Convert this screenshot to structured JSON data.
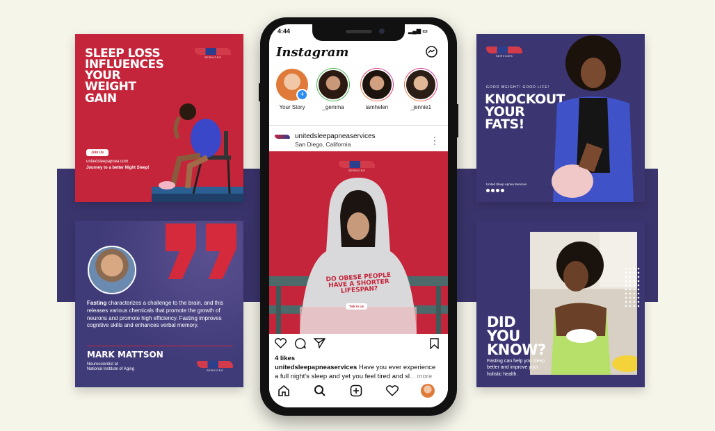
{
  "card1": {
    "headline": [
      "SLEEP LOSS",
      "INFLUENCES",
      "YOUR",
      "WEIGHT",
      "GAIN"
    ],
    "button": "Join Us",
    "website": "unitedsleepapnea.com",
    "tagline": "Journey to a better Night Sleep!"
  },
  "card2": {
    "quote_lead": "Fasting",
    "quote_rest": " characterizes a challenge to the brain, and this releases various chemicals that promote the growth of neurons and promote high efficiency. Fasting improves cognitive skills and enhances verbal memory.",
    "name": "MARK MATTSON",
    "role_line1": "Neuroscientist at",
    "role_line2": "National Institute of Aging"
  },
  "card3": {
    "kicker": "GOOD WEIGHT! GOOD LIFE!",
    "headline": [
      "KNOCKOUT",
      "YOUR",
      "FATS!"
    ],
    "brand": "United Sleep Apnea Services"
  },
  "card4": {
    "headline": [
      "DID",
      "YOU",
      "KNOW?"
    ],
    "body": [
      "Fasting can help you sleep",
      "better and improve your",
      "holistic health."
    ]
  },
  "phone": {
    "time": "4:44",
    "app_title": "Instagram",
    "stories": [
      {
        "name": "Your Story"
      },
      {
        "name": "_gemma"
      },
      {
        "name": "iamhelen"
      },
      {
        "name": "_jennie1"
      }
    ],
    "post": {
      "account": "unitedsleepapneaservices",
      "location": "San Diego, California",
      "shirt_text": [
        "DO OBESE PEOPLE",
        "HAVE A SHORTER",
        "LIFESPAN?"
      ],
      "button": "Talk to Us",
      "likes": "4 likes",
      "caption_user": "unitedsleepapneaservices",
      "caption_line1": " Have you ever experience",
      "caption_line2": "a full night's sleep and yet you feel tired and sl",
      "more": "... more"
    }
  },
  "colors": {
    "red": "#c4253a",
    "navy": "#3b3572",
    "background": "#f6f5ea"
  }
}
